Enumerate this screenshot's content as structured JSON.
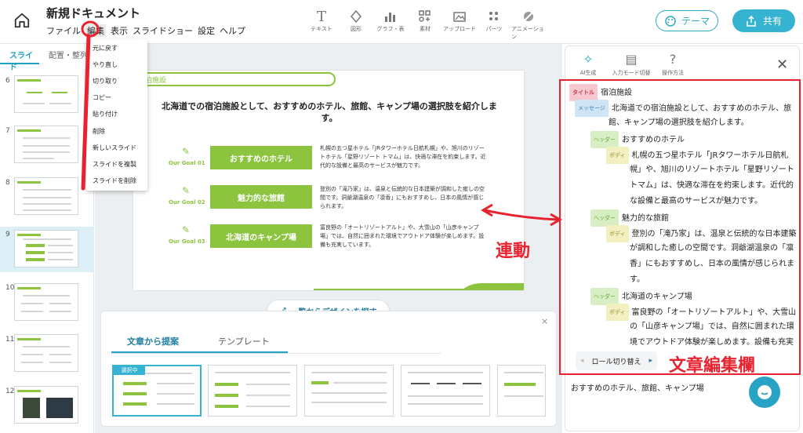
{
  "header": {
    "doc_title": "新規ドキュメント",
    "menu": [
      "ファイル",
      "編集",
      "表示",
      "スライドショー",
      "設定",
      "ヘルプ"
    ],
    "tools": [
      {
        "icon": "text-icon",
        "label": "テキスト"
      },
      {
        "icon": "shape-icon",
        "label": "図形"
      },
      {
        "icon": "chart-icon",
        "label": "グラフ・表"
      },
      {
        "icon": "material-icon",
        "label": "素材"
      },
      {
        "icon": "upload-icon",
        "label": "アップロード"
      },
      {
        "icon": "parts-icon",
        "label": "パーツ"
      },
      {
        "icon": "animation-icon",
        "label": "アニメーション"
      }
    ],
    "theme_label": "テーマ",
    "share_label": "共有"
  },
  "edit_menu": {
    "items": [
      "元に戻す",
      "やり直し",
      "切り取り",
      "コピー",
      "貼り付け",
      "削除",
      "新しいスライド",
      "スライドを複製",
      "スライドを削除"
    ]
  },
  "left_panel": {
    "tabs": [
      "スライド",
      "配置・整列"
    ],
    "slide_numbers": [
      "6",
      "7",
      "8",
      "9",
      "10",
      "11",
      "12"
    ],
    "selected": "9"
  },
  "slide": {
    "section_title": "宿泊施設",
    "heading": "北海道での宿泊施設として、おすすめのホテル、旅館、キャンプ場の選択肢を紹介します。",
    "goals": [
      {
        "label": "Our Goal 01",
        "title": "おすすめのホテル",
        "text": "札幌の五つ星ホテル「JRタワーホテル日航札幌」や、旭川のリゾートホテル「星野リゾート トマム」は、快適な滞在を約束します。近代的な設備と最高のサービスが魅力です。"
      },
      {
        "label": "Our Goal 02",
        "title": "魅力的な旅館",
        "text": "登別の「滝乃家」は、温泉と伝統的な日本建築が調和した癒しの空間です。洞爺湖温泉の「凛香」にもおすすめし、日本の風情が感じられます。"
      },
      {
        "label": "Our Goal 03",
        "title": "北海道のキャンプ場",
        "text": "富良野の「オートリゾートアルト」や、大雪山の「山彦キャンプ場」では、自然に囲まれた環境でアウトドア体験が楽しめます。設備も充実しています。"
      }
    ]
  },
  "find_design_label": "一覧からデザインを探す",
  "suggestions": {
    "tabs": [
      "文章から提案",
      "テンプレート"
    ],
    "selected_badge": "選択中",
    "close_glyph": "×"
  },
  "right_panel": {
    "tools": [
      {
        "icon": "ai-sparkle-icon",
        "label": "AI生成"
      },
      {
        "icon": "input-mode-icon",
        "label": "入力モード切替"
      },
      {
        "icon": "help-icon",
        "label": "操作方法"
      }
    ],
    "close_glyph": "✕",
    "tags": {
      "title": "タイトル",
      "message": "メッセージ",
      "header": "ヘッダー",
      "body": "ボディ"
    },
    "entries": {
      "title": "宿泊施設",
      "message": [
        "北海道での宿泊施設として、おすすめのホテル、旅",
        "館、キャンプ場の選択肢を紹介します。"
      ],
      "header1": "おすすめのホテル",
      "body1": [
        "札幌の五つ星ホテル「JRタワーホテル日航札",
        "幌」や、旭川のリゾートホテル「星野リゾート",
        "トマム」は、快適な滞在を約束します。近代的",
        "な設備と最高のサービスが魅力です。"
      ],
      "header2": "魅力的な旅館",
      "body2": [
        "登別の「滝乃家」は、温泉と伝統的な日本建築",
        "が調和した癒しの空間です。洞爺湖温泉の「凛",
        "香」にもおすすめし、日本の風情が感じられま",
        "す。"
      ],
      "header3": "北海道のキャンプ場",
      "body3": [
        "富良野の「オートリゾートアルト」や、大雪山",
        "の「山彦キャンプ場」では、自然に囲まれた環",
        "境でアウトドア体験が楽しめます。設備も充実"
      ]
    },
    "role_switch": "ロール切り替え",
    "bottom_text": "おすすめのホテル、旅館、キャンプ場"
  },
  "annotations": {
    "link_label": "連動",
    "editor_label": "文章編集欄",
    "color": "#e8222e"
  },
  "colors": {
    "accent": "#35b3d1",
    "slide_green": "#8cc43f"
  }
}
